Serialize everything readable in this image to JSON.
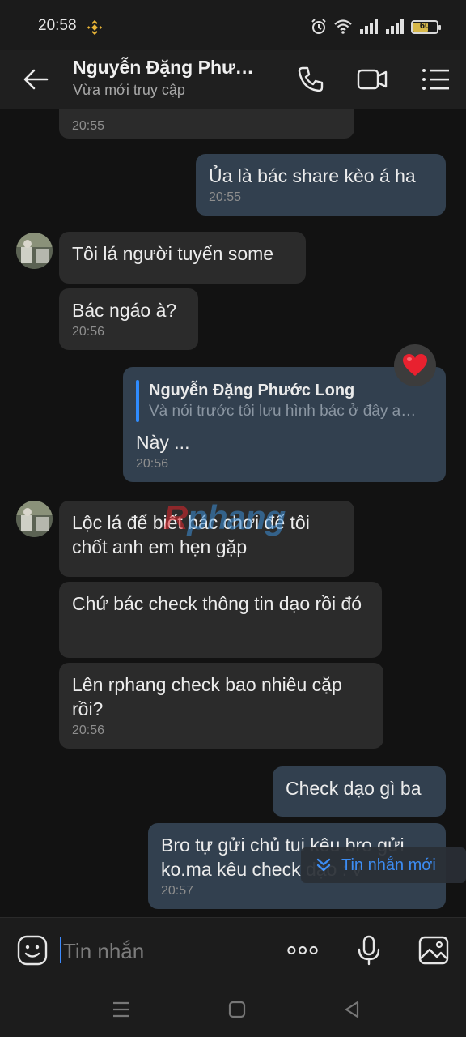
{
  "status": {
    "time": "20:58",
    "battery": "60",
    "battery_level": 0.6
  },
  "header": {
    "name": "Nguyễn Đặng Phư…",
    "status": "Vừa mới truy cập"
  },
  "messages": [
    {
      "side": "in",
      "text": "",
      "time": "20:55"
    },
    {
      "side": "out",
      "text": "Ủa là bác share kèo á ha",
      "time": "20:55"
    },
    {
      "side": "in",
      "text": "Tôi lá người tuyển some",
      "time": ""
    },
    {
      "side": "in",
      "text": "Bác ngáo à?",
      "time": "20:56"
    },
    {
      "side": "out",
      "quote_name": "Nguyễn Đặng Phước Long",
      "quote_text": "Và nói trước tôi lưu hình bác ở đây a…",
      "text": "Này ...",
      "time": "20:56",
      "reaction": "heart"
    },
    {
      "side": "in",
      "text": "Lộc lá để biết bác chơi để tôi chốt anh em hẹn gặp",
      "time": ""
    },
    {
      "side": "in",
      "text": "Chứ bác check thông tin dạo rồi đó",
      "time": ""
    },
    {
      "side": "in",
      "text": "Lên rphang check bao nhiêu cặp rồi?",
      "time": "20:56"
    },
    {
      "side": "out",
      "text": "Check dạo gì ba",
      "time": ""
    },
    {
      "side": "out",
      "text": "Bro tự gửi chủ tui kêu bro gửi ko.ma kêu check dạo : v",
      "time": "20:57"
    }
  ],
  "watermark": {
    "r": "R",
    "rest": "phang"
  },
  "new_message_label": "Tin nhắn mới",
  "input": {
    "placeholder": "Tin nhắn"
  },
  "colors": {
    "incoming_bubble": "#2b2b2b",
    "outgoing_bubble": "#32404f",
    "accent": "#3d8bff",
    "reaction_heart": "#e8212f"
  },
  "icons": {
    "back": "arrow-left-icon",
    "call": "phone-icon",
    "video": "video-camera-icon",
    "menu": "list-menu-icon",
    "sticker": "smiley-sticker-icon",
    "more": "more-dots-icon",
    "mic": "microphone-icon",
    "image": "image-gallery-icon"
  }
}
